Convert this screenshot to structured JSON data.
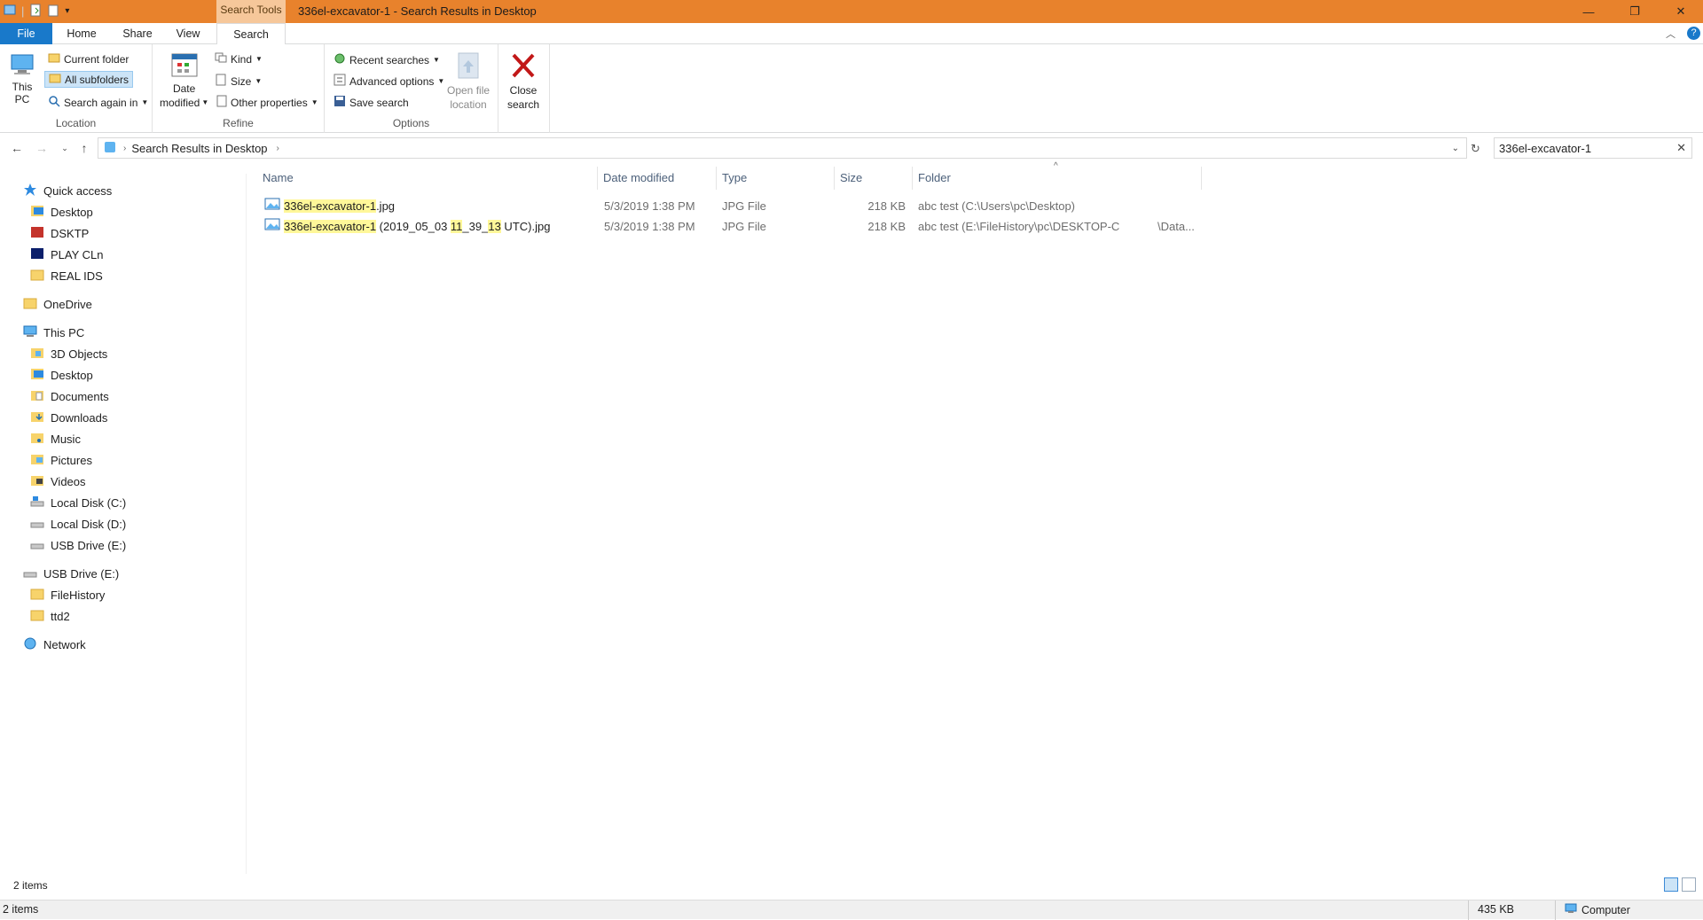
{
  "window": {
    "title": "336el-excavator-1 - Search Results in Desktop",
    "context_tab": "Search Tools",
    "minimize": "—",
    "restore": "❐",
    "close": "✕"
  },
  "ribbon_tabs": [
    "File",
    "Home",
    "Share",
    "View",
    "Search"
  ],
  "ribbon": {
    "location": {
      "this_pc": "This PC",
      "current_folder": "Current folder",
      "all_subfolders": "All subfolders",
      "search_again_in": "Search again in",
      "label": "Location"
    },
    "refine": {
      "date_modified_1": "Date",
      "date_modified_2": "modified",
      "kind": "Kind",
      "size": "Size",
      "other_properties": "Other properties",
      "label": "Refine"
    },
    "options": {
      "recent_searches": "Recent searches",
      "advanced_options": "Advanced options",
      "save_search": "Save search",
      "open_file_location_1": "Open file",
      "open_file_location_2": "location",
      "label": "Options"
    },
    "close_search_1": "Close",
    "close_search_2": "search"
  },
  "address": {
    "breadcrumb": "Search Results in Desktop",
    "search_value": "336el-excavator-1"
  },
  "nav": {
    "quick_access": "Quick access",
    "quick_items": [
      "Desktop",
      "DSKTP",
      "PLAY CLn",
      "REAL IDS"
    ],
    "onedrive": "OneDrive",
    "this_pc": "This PC",
    "pc_items": [
      "3D Objects",
      "Desktop",
      "Documents",
      "Downloads",
      "Music",
      "Pictures",
      "Videos",
      "Local Disk (C:)",
      "Local Disk (D:)",
      "USB Drive (E:)"
    ],
    "usb": "USB Drive (E:)",
    "usb_items": [
      "FileHistory",
      "ttd2"
    ],
    "network": "Network"
  },
  "columns": [
    "Name",
    "Date modified",
    "Type",
    "Size",
    "Folder"
  ],
  "files": [
    {
      "name_hl": "336el-excavator-1",
      "name_rest": ".jpg",
      "date": "5/3/2019 1:38 PM",
      "type": "JPG File",
      "size": "218 KB",
      "folder": "abc test (C:\\Users\\pc\\Desktop)",
      "folder_extra": ""
    },
    {
      "name_hl": "336el-excavator-1",
      "name_mid1": " (2019_05_03 ",
      "name_hl2": "11",
      "name_mid2": "_39_",
      "name_hl3": "13",
      "name_rest": " UTC).jpg",
      "date": "5/3/2019 1:38 PM",
      "type": "JPG File",
      "size": "218 KB",
      "folder": "abc test (E:\\FileHistory\\pc\\DESKTOP-C",
      "folder_extra": "\\Data..."
    }
  ],
  "status": {
    "items": "2 items",
    "bar_items": "2 items",
    "total_size": "435 KB",
    "location": "Computer"
  },
  "colors": {
    "titlebar": "#e8822c",
    "file_tab": "#1979ca",
    "highlight": "#fff799"
  }
}
